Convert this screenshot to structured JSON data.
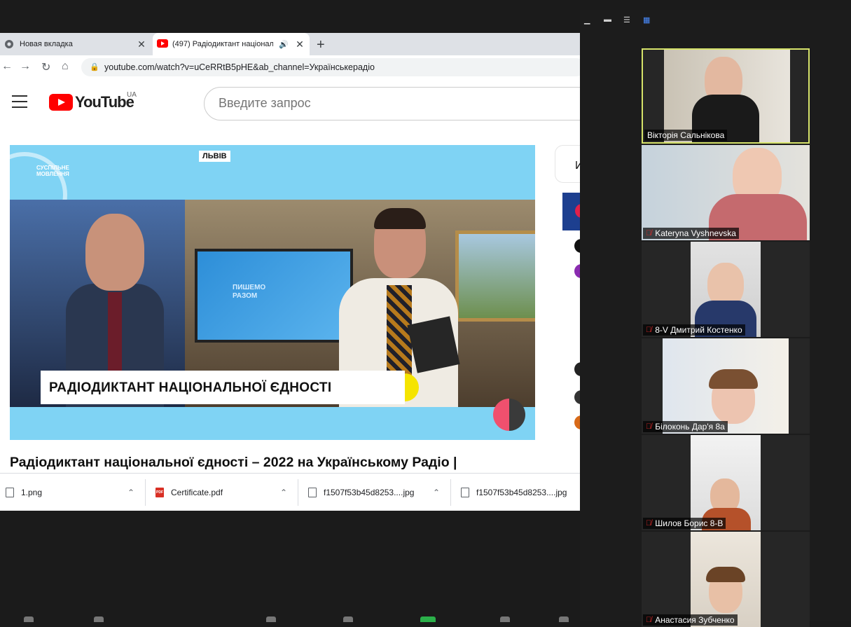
{
  "browser": {
    "tabs": [
      {
        "label": "Новая вкладка",
        "icon": "chrome-icon"
      },
      {
        "label": "(497) Радіодиктант національ",
        "icon": "youtube-icon",
        "audio": true
      }
    ],
    "address": "youtube.com/watch?v=uCeRRtB5pHE&ab_channel=Українськерадіо"
  },
  "youtube": {
    "logo": "YouTube",
    "region": "UA",
    "search_placeholder": "Введите запрос",
    "video": {
      "broadcaster": [
        "СУСПІЛЬНЕ",
        "МОВЛЕННЯ"
      ],
      "location_tag": "ЛЬВІВ",
      "screen_text": [
        "ПИШЕМО",
        "РАЗОМ"
      ],
      "lower_third": "РАДІОДИКТАНТ НАЦІОНАЛЬНОЇ ЄДНОСТІ"
    },
    "title": "Радіодиктант національної єдності – 2022 на Українському Радіо |",
    "side_panel_label": "И"
  },
  "downloads": [
    {
      "name": "1.png",
      "type": "file"
    },
    {
      "name": "Certificate.pdf",
      "type": "pdf"
    },
    {
      "name": "f1507f53b45d8253....jpg",
      "type": "file"
    },
    {
      "name": "f1507f53b45d8253....jpg",
      "type": "file"
    }
  ],
  "zoom": {
    "participants": [
      {
        "name": "Вікторія Сальнікова",
        "muted": false,
        "active": true
      },
      {
        "name": "Kateryna Vyshnevska",
        "muted": true,
        "active": false
      },
      {
        "name": "8-V Дмитрий Костенко",
        "muted": true,
        "active": false
      },
      {
        "name": "Білоконь Дар'я 8а",
        "muted": true,
        "active": false
      },
      {
        "name": "Шилов Борис 8-В",
        "muted": true,
        "active": false
      },
      {
        "name": "Анастасия Зубченко",
        "muted": true,
        "active": false
      }
    ]
  },
  "colors": {
    "youtube_red": "#ff0000",
    "active_border": "#d6e36a",
    "muted_red": "#e02828"
  }
}
